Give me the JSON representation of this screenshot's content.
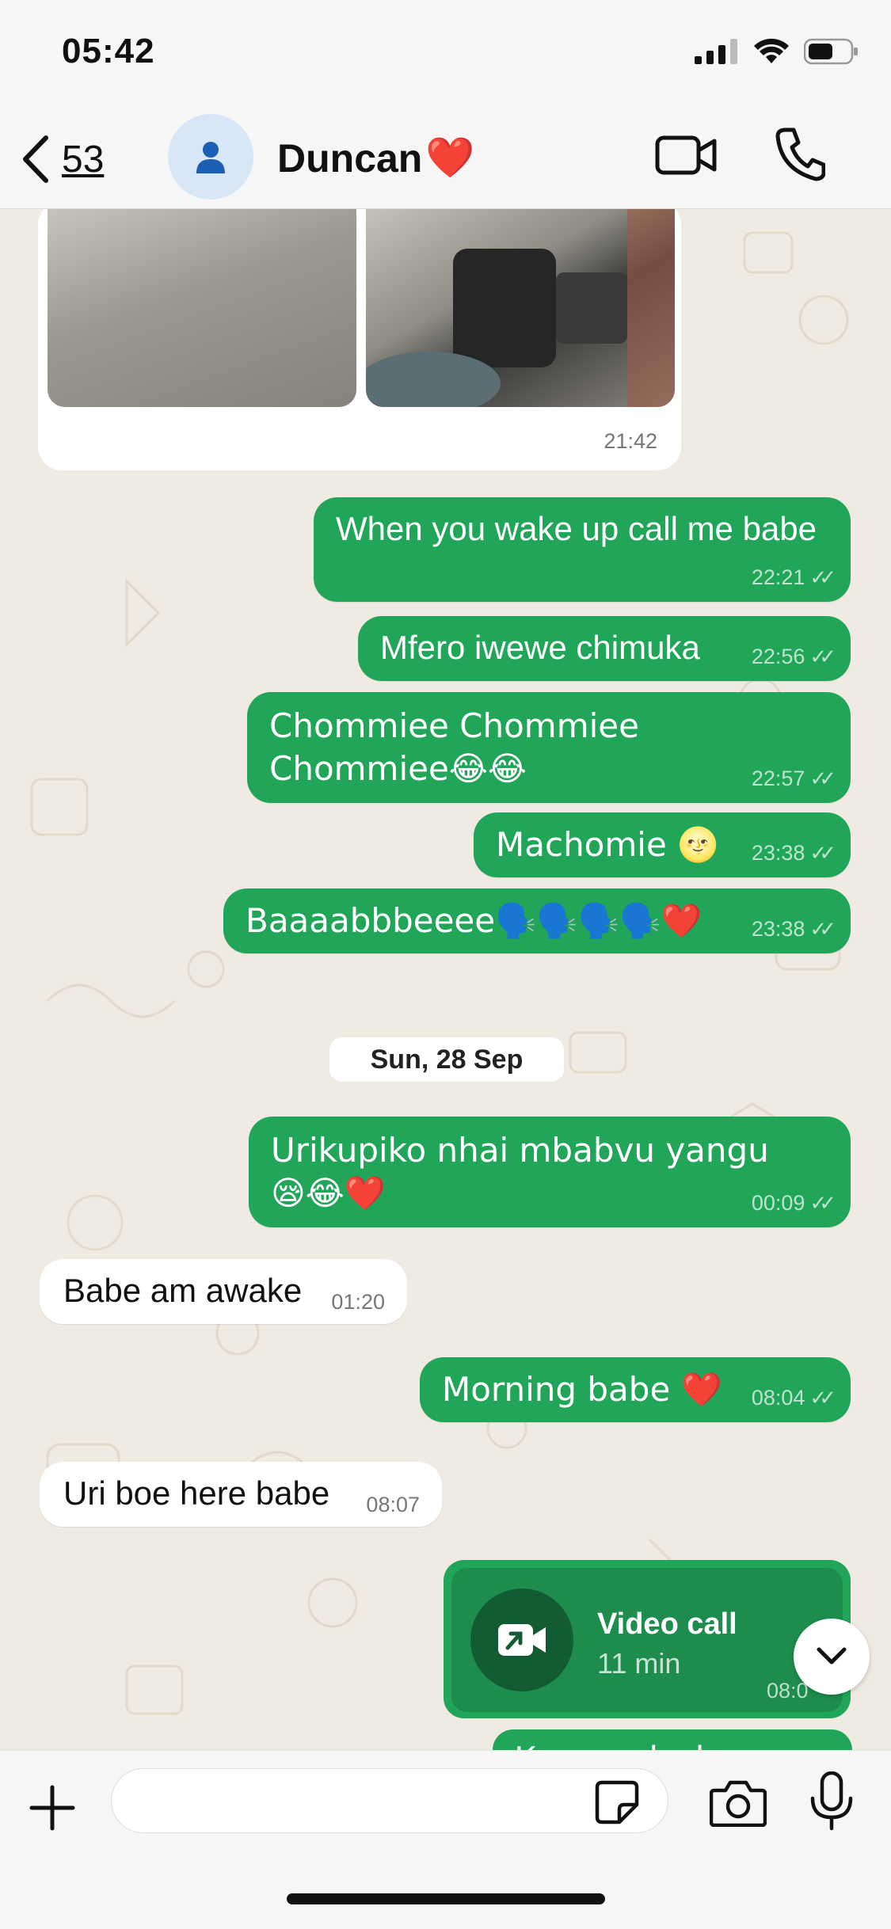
{
  "status_bar": {
    "time": "05:42"
  },
  "header": {
    "back_count": "53",
    "contact_name": "Duncan",
    "contact_heart": "❤️",
    "icons": [
      "chevron-left-icon",
      "person-icon",
      "video-camera-icon",
      "phone-icon"
    ]
  },
  "image_message": {
    "time": "21:42"
  },
  "messages_out_1": [
    {
      "text": "When you wake up call me babe",
      "time": "22:21"
    },
    {
      "text": "Mfero iwewe chimuka",
      "time": "22:56"
    },
    {
      "text": "Chommiee Chommiee Chommiee😂😂",
      "time": "22:57"
    },
    {
      "text": "Machomie 🌝",
      "time": "23:38"
    },
    {
      "text": "Baaaabbbeeee🗣️🗣️🗣️🗣️❤️",
      "time": "23:38"
    }
  ],
  "date_chip": "Sun, 28 Sep",
  "messages_day2": [
    {
      "text": "Urikupiko nhai mbabvu yangu 😪😂❤️",
      "time": "00:09",
      "dir": "out"
    },
    {
      "text": "Babe am awake",
      "time": "01:20",
      "dir": "in"
    },
    {
      "text": "Morning babe ❤️",
      "time": "08:04",
      "dir": "out"
    },
    {
      "text": "Uri boe here babe",
      "time": "08:07",
      "dir": "in"
    }
  ],
  "video_call": {
    "title": "Video call",
    "duration": "11 min",
    "time": "08:0"
  },
  "partial_message": "Kunapro ha kw",
  "input_bar": {
    "placeholder": ""
  },
  "colors": {
    "outgoing_bubble": "#21a559",
    "incoming_bubble": "#ffffff",
    "chat_background": "#efeae2",
    "header_background": "#f6f6f6"
  }
}
